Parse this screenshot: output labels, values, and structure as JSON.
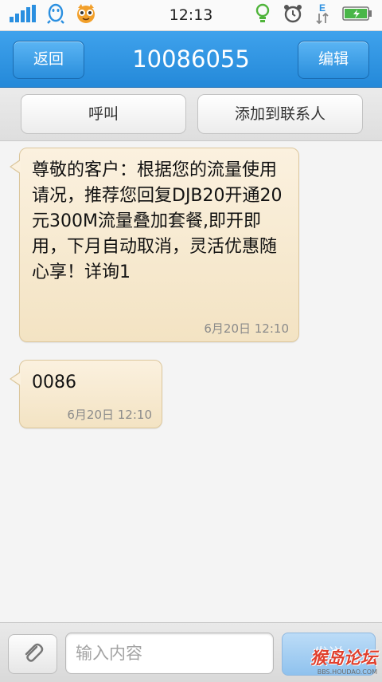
{
  "status_bar": {
    "time": "12:13",
    "icons": [
      "signal-icon",
      "qq-penguin-icon",
      "app-mascot-icon",
      "lightbulb-icon",
      "alarm-clock-icon",
      "data-transfer-icon",
      "battery-icon"
    ],
    "network_type": "E"
  },
  "header": {
    "back_label": "返回",
    "title": "10086055",
    "edit_label": "编辑",
    "accent_color": "#2b8fde"
  },
  "actions": {
    "call_label": "呼叫",
    "add_contact_label": "添加到联系人"
  },
  "messages": [
    {
      "text": "尊敬的客户：根据您的流量使用请况，推荐您回复DJB20开通20元300M流量叠加套餐,即开即用，下月自动取消，灵活优惠随心享！详询1",
      "time": "6月20日 12:10"
    },
    {
      "text": "0086",
      "time": "6月20日 12:10"
    }
  ],
  "composer": {
    "placeholder": "输入内容",
    "send_label": "发送"
  },
  "watermark": {
    "main": "猴岛论坛",
    "sub": "BBS.HOUDAO.COM"
  }
}
